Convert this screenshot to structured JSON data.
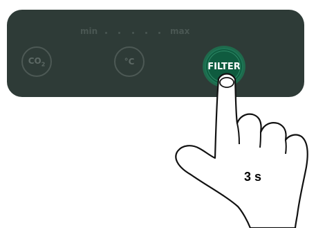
{
  "scale": {
    "min_label": "min",
    "max_label": "max",
    "dot_count": 5
  },
  "buttons": {
    "co2_label_main": "CO",
    "co2_label_sub": "2",
    "temp_label": "°C",
    "filter_label": "FILTER"
  },
  "instruction": {
    "duration_label": "3 s"
  },
  "colors": {
    "panel": "#2e3b37",
    "inactive": "#4d5955",
    "filter_fill": "#0f5b3f",
    "filter_ring": "#1f6a4c"
  }
}
